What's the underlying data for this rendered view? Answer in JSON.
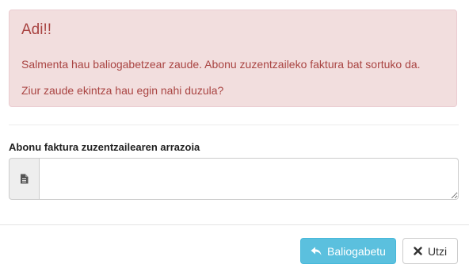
{
  "alert": {
    "title": "Adi!!",
    "message": "Salmenta hau baliogabetzear zaude. Abonu zuzentzaileko faktura bat sortuko da.",
    "question": "Ziur zaude ekintza hau egin nahi duzula?",
    "color": "#a94442",
    "background": "#f2dede"
  },
  "form": {
    "reason_label": "Abonu faktura zuzentzailearen arrazoia",
    "reason_value": "",
    "addon_icon": "document-icon"
  },
  "footer": {
    "confirm_label": "Baliogabetu",
    "confirm_icon": "reply-icon",
    "confirm_color": "#5bc0de",
    "cancel_label": "Utzi",
    "cancel_icon": "close-icon"
  }
}
